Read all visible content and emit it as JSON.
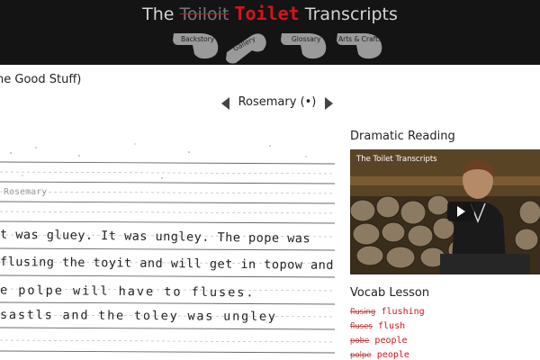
{
  "header": {
    "title_prefix": "The",
    "title_struck": "Toiloit",
    "title_highlight": "Toilet",
    "title_suffix": "Transcripts"
  },
  "nav": {
    "backstory": "Backstory",
    "gallery": "Gallery",
    "glossary": "Glossary",
    "arts": "Arts & Crafts"
  },
  "breadcrumb": "he Good Stuff)",
  "pager": {
    "title": "Rosemary (•)"
  },
  "transcript": {
    "name_line": "Rosemary",
    "lines": [
      "t was gluey. It was ungley. The pope was",
      "flusing the toyit and will get in topow and",
      "e polpe will have to fluses.",
      "sastls and the toley was ungley"
    ]
  },
  "dramatic_reading": {
    "heading": "Dramatic Reading",
    "video_title": "The Toilet Transcripts"
  },
  "vocab": {
    "heading": "Vocab Lesson",
    "items": [
      {
        "wrong": "flusing",
        "right": "flushing"
      },
      {
        "wrong": "fluses",
        "right": "flush"
      },
      {
        "wrong": "pobe",
        "right": "people"
      },
      {
        "wrong": "polpe",
        "right": "people"
      }
    ]
  },
  "colors": {
    "header_bg": "#141414",
    "accent_red": "#d6131b",
    "nav_shape": "#9a9a9a"
  }
}
